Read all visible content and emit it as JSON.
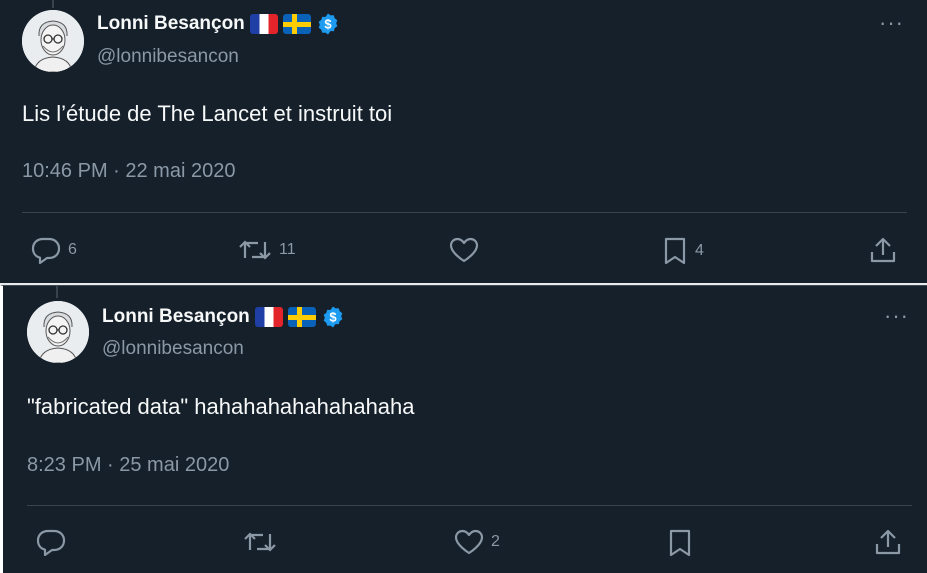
{
  "tweets": [
    {
      "author_name": "Lonni Besançon",
      "author_handle": "@lonnibesancon",
      "text": "Lis l’étude de The Lancet et instruit toi",
      "timestamp": "10:46 PM · 22 mai 2020",
      "replies": "6",
      "retweets": "11",
      "likes": "",
      "bookmarks": "4"
    },
    {
      "author_name": "Lonni Besançon",
      "author_handle": "@lonnibesancon",
      "text": "\"fabricated data\" hahahahahahahahaha",
      "timestamp": "8:23 PM · 25 mai 2020",
      "replies": "",
      "retweets": "",
      "likes": "2",
      "bookmarks": ""
    }
  ],
  "more_label": "···",
  "colors": {
    "background": "#15202b",
    "text_primary": "#f7f9f9",
    "text_secondary": "#8b98a5",
    "verified_badge": "#1d9bf0",
    "divider": "#38444d"
  },
  "icons": [
    "reply-icon",
    "retweet-icon",
    "like-icon",
    "bookmark-icon",
    "share-icon",
    "verified-icon",
    "more-icon",
    "flag-france-icon",
    "flag-sweden-icon"
  ]
}
